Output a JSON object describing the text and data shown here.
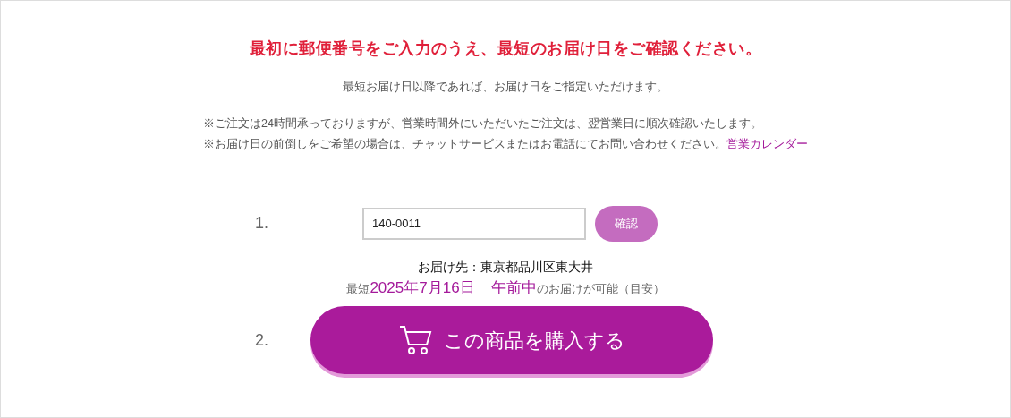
{
  "heading": "最初に郵便番号をご入力のうえ、最短のお届け日をご確認ください。",
  "subheading": "最短お届け日以降であれば、お届け日をご指定いただけます。",
  "notes": [
    "※ご注文は24時間承っておりますが、営業時間外にいただいたご注文は、翌営業日に順次確認いたします。",
    "※お届け日の前倒しをご希望の場合は、チャットサービスまたはお電話にてお問い合わせください。"
  ],
  "calendar_link": "営業カレンダー",
  "step_1": {
    "number": "1.",
    "postal_code": "140-0011",
    "confirm_button": "確認"
  },
  "destination": "お届け先：東京都品川区東大井",
  "earliest": {
    "prefix": "最短",
    "date": "2025年7月16日",
    "slot": "午前中",
    "suffix": "のお届けが可能（目安）"
  },
  "step_2": {
    "number": "2.",
    "purchase_button": "この商品を購入する"
  }
}
